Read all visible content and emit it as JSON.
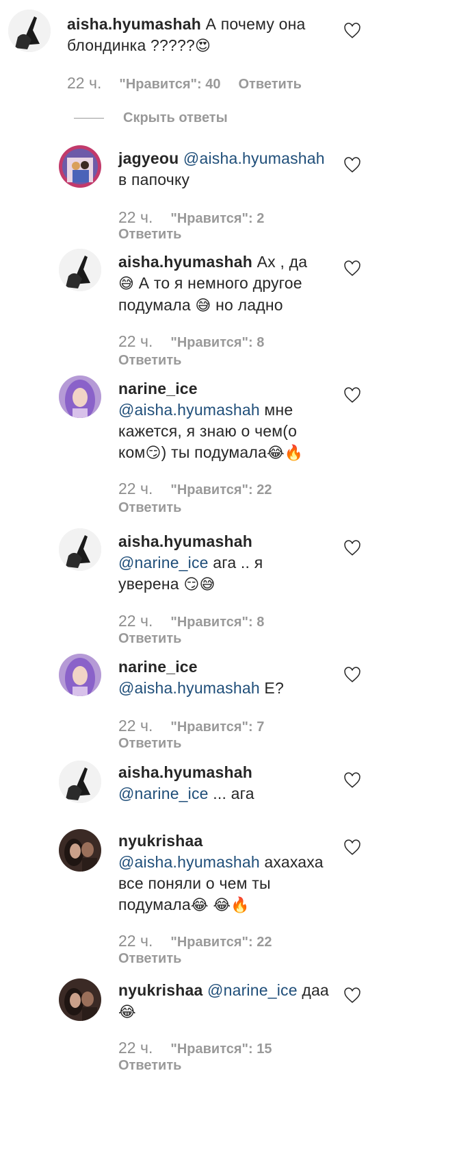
{
  "comments": [
    {
      "user": "aisha.hyumashah",
      "parts": [
        " А почему она",
        "блондинка ?????"
      ],
      "emoji_end": "😍",
      "time": "22 ч.",
      "likes": "\"Нравится\": 40",
      "reply": "Ответить"
    },
    {
      "user": "jagyeou",
      "mention": "@aisha.hyumashah",
      "text": "в папочку",
      "time": "22 ч.",
      "likes": "\"Нравится\": 2",
      "reply": "Ответить"
    },
    {
      "user": "aisha.hyumashah",
      "line1": " Ах , да",
      "line2_emoji": "😅",
      "line2": " А то я немного другое",
      "line3a": "подумала ",
      "line3_emoji": "😅",
      "line3b": " но ладно",
      "time": "22 ч.",
      "likes": "\"Нравится\": 8",
      "reply": "Ответить"
    },
    {
      "user": "narine_ice",
      "mention": "@aisha.hyumashah",
      "after_mention": " мне",
      "line2": "кажется, я знаю о чем(о",
      "line3a": "ком",
      "emoji_a": "😏",
      "line3b": ") ты подумала",
      "emoji_b": "😂",
      "emoji_c": "🔥",
      "time": "22 ч.",
      "likes": "\"Нравится\": 22",
      "reply": "Ответить"
    },
    {
      "user": "aisha.hyumashah",
      "mention": "@narine_ice",
      "after_mention": " ага .. я",
      "line2": "уверена ",
      "emoji_a": "😏",
      "emoji_b": "😅",
      "time": "22 ч.",
      "likes": "\"Нравится\": 8",
      "reply": "Ответить"
    },
    {
      "user": "narine_ice",
      "mention": "@aisha.hyumashah",
      "after_mention": " Е?",
      "time": "22 ч.",
      "likes": "\"Нравится\": 7",
      "reply": "Ответить"
    },
    {
      "user": "aisha.hyumashah",
      "mention": "@narine_ice",
      "after_mention": " ... ага"
    },
    {
      "user": "nyukrishaa",
      "mention": "@aisha.hyumashah",
      "after_mention": " ахахаха",
      "line2": "все поняли о чем ты",
      "line3": "подумала",
      "emoji_a": "😂",
      "emoji_b": "😂",
      "emoji_c": "🔥",
      "time": "22 ч.",
      "likes": "\"Нравится\": 22",
      "reply": "Ответить"
    },
    {
      "user": "nyukrishaa",
      "mention": "@narine_ice",
      "after_mention": " даа",
      "emoji_a": "😂",
      "time": "22 ч.",
      "likes": "\"Нравится\": 15",
      "reply": "Ответить"
    }
  ],
  "hide_replies": "Скрыть ответы",
  "icons": {
    "like": "heart-outline-icon"
  },
  "colors": {
    "mention": "#1f4e79",
    "meta": "#999999"
  }
}
